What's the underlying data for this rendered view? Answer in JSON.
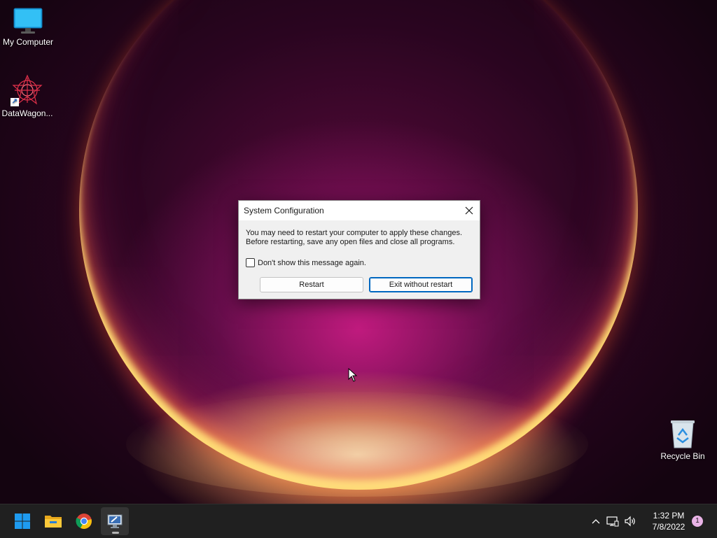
{
  "desktop": {
    "icons": [
      {
        "label": "My Computer",
        "icon": "monitor-icon"
      },
      {
        "label": "DataWagon...",
        "icon": "datawagon-app-icon"
      },
      {
        "label": "Recycle Bin",
        "icon": "recycle-bin-icon"
      }
    ]
  },
  "dialog": {
    "title": "System Configuration",
    "message_line1": "You may need to restart your computer to apply these changes.",
    "message_line2": "Before restarting, save any open files and close all programs.",
    "checkbox_label": "Don't show this message again.",
    "checkbox_checked": false,
    "restart_label": "Restart",
    "exit_label": "Exit without restart",
    "close_icon": "close-icon"
  },
  "taskbar": {
    "apps": [
      {
        "name": "start",
        "icon": "windows-start-icon"
      },
      {
        "name": "file-explorer",
        "icon": "folder-icon"
      },
      {
        "name": "chrome",
        "icon": "chrome-icon"
      },
      {
        "name": "system-configuration",
        "icon": "msconfig-icon",
        "active": true
      }
    ],
    "tray_icons": [
      "chevron-up-icon",
      "network-icon",
      "volume-icon"
    ],
    "time": "1:32 PM",
    "date": "7/8/2022",
    "notification_count": "1"
  },
  "colors": {
    "accent": "#0067c0",
    "taskbar_bg": "#202020",
    "dialog_bg": "#f0f0f0"
  }
}
